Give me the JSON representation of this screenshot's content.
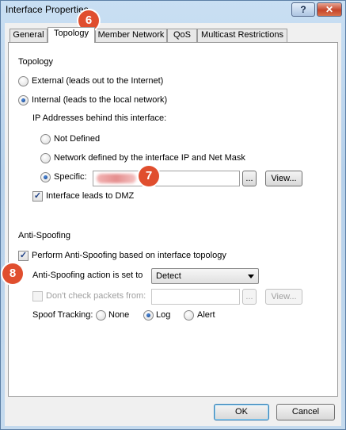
{
  "window": {
    "title": "Interface Properties",
    "help_label": "?",
    "close_label": "✕"
  },
  "tabs": [
    {
      "label": "General"
    },
    {
      "label": "Topology"
    },
    {
      "label": "Member Network"
    },
    {
      "label": "QoS"
    },
    {
      "label": "Multicast Restrictions"
    }
  ],
  "active_tab": "Topology",
  "topology": {
    "heading": "Topology",
    "external_label": "External (leads out to the Internet)",
    "internal_label": "Internal (leads to the local network)",
    "selected": "internal",
    "ip_heading": "IP Addresses behind this interface:",
    "not_defined_label": "Not Defined",
    "network_defined_label": "Network defined by the interface IP and Net Mask",
    "specific_label": "Specific:",
    "ip_selected": "specific",
    "ellipsis_label": "...",
    "view_label": "View...",
    "dmz_label": "Interface leads to DMZ",
    "dmz_checked": true
  },
  "anti_spoofing": {
    "heading": "Anti-Spoofing",
    "perform_label": "Perform Anti-Spoofing based on interface topology",
    "perform_checked": true,
    "action_label": "Anti-Spoofing action is set to",
    "action_value": "Detect",
    "dont_check_label": "Don't check packets from:",
    "dont_check_checked": false,
    "ellipsis_label": "...",
    "view_label": "View...",
    "spoof_tracking_label": "Spoof Tracking:",
    "tracking_options": [
      "None",
      "Log",
      "Alert"
    ],
    "tracking_selected": "Log"
  },
  "buttons": {
    "ok": "OK",
    "cancel": "Cancel"
  },
  "badges": {
    "b6": "6",
    "b7": "7",
    "b8": "8"
  },
  "colors": {
    "badge": "#e04e2e",
    "window_frame": "#b6d0ea",
    "close_button": "#c6452a"
  }
}
